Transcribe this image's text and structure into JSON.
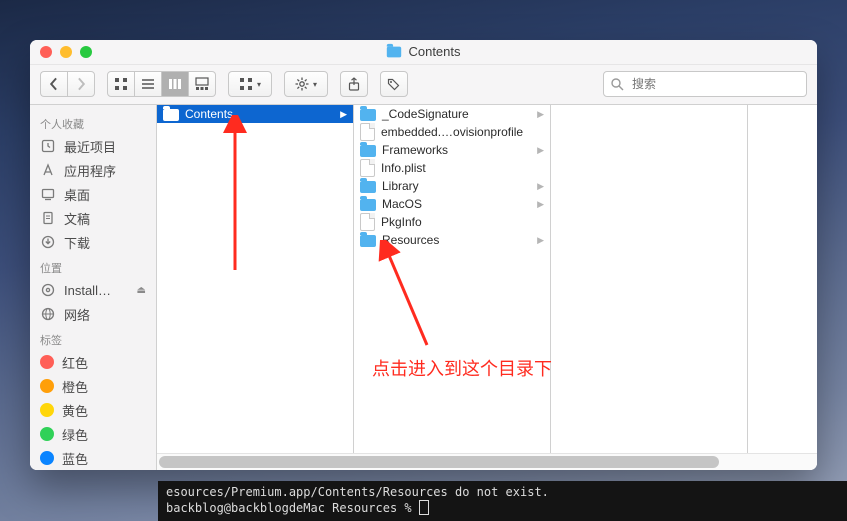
{
  "window_title": "Contents",
  "toolbar": {
    "search_placeholder": "搜索"
  },
  "sidebar": {
    "sections": [
      {
        "header": "个人收藏",
        "items": [
          {
            "icon": "recents",
            "label": "最近项目"
          },
          {
            "icon": "apps",
            "label": "应用程序"
          },
          {
            "icon": "desktop",
            "label": "桌面"
          },
          {
            "icon": "documents",
            "label": "文稿"
          },
          {
            "icon": "downloads",
            "label": "下载"
          }
        ]
      },
      {
        "header": "位置",
        "items": [
          {
            "icon": "disc",
            "label": "Install…",
            "eject": true
          },
          {
            "icon": "globe",
            "label": "网络"
          }
        ]
      },
      {
        "header": "标签",
        "items": [
          {
            "icon": "tag",
            "color": "red",
            "label": "红色"
          },
          {
            "icon": "tag",
            "color": "orange",
            "label": "橙色"
          },
          {
            "icon": "tag",
            "color": "yellow",
            "label": "黄色"
          },
          {
            "icon": "tag",
            "color": "green",
            "label": "绿色"
          },
          {
            "icon": "tag",
            "color": "blue",
            "label": "蓝色"
          }
        ]
      }
    ]
  },
  "columns": [
    {
      "items": [
        {
          "type": "folder",
          "name": "Contents",
          "selected": true,
          "has_children": true
        }
      ]
    },
    {
      "items": [
        {
          "type": "folder",
          "name": "_CodeSignature",
          "has_children": true
        },
        {
          "type": "file",
          "name": "embedded.…ovisionprofile"
        },
        {
          "type": "folder",
          "name": "Frameworks",
          "has_children": true
        },
        {
          "type": "file",
          "name": "Info.plist"
        },
        {
          "type": "folder",
          "name": "Library",
          "has_children": true
        },
        {
          "type": "folder",
          "name": "MacOS",
          "has_children": true
        },
        {
          "type": "file",
          "name": "PkgInfo"
        },
        {
          "type": "folder",
          "name": "Resources",
          "has_children": true
        }
      ]
    },
    {
      "items": []
    }
  ],
  "annotation_text": "点击进入到这个目录下",
  "terminal": {
    "line1": "esources/Premium.app/Contents/Resources do not exist.",
    "line2_prefix": "backblog@backblogdeMac Resources % "
  }
}
